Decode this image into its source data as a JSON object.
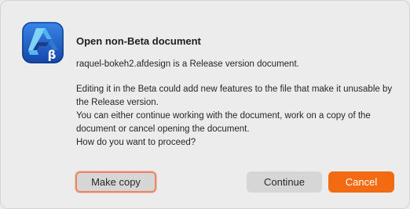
{
  "dialog": {
    "title": "Open non-Beta document",
    "message_line1": "raquel-bokeh2.afdesign is a Release version document.",
    "message_para2": "Editing it in the Beta could add new features to the file that make it unusable by the Release version.\nYou can either continue working with the document, work on a copy of the document or cancel opening the document.",
    "question": "How do you want to proceed?",
    "app_icon": "affinity-designer-beta-icon",
    "icon_badge": "β"
  },
  "buttons": {
    "make_copy": "Make copy",
    "continue": "Continue",
    "cancel": "Cancel"
  },
  "colors": {
    "accent": "#f26b13",
    "focus_ring": "#e5896a",
    "icon_background": "#1d5bbf"
  }
}
